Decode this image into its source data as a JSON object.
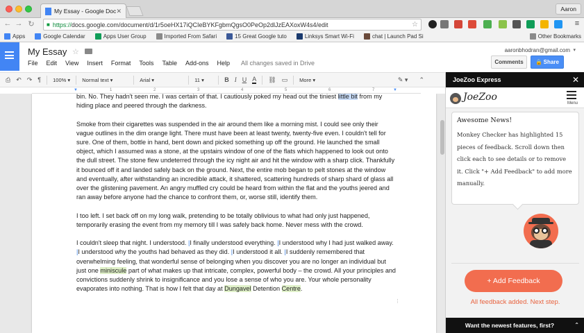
{
  "browser": {
    "tab_title": "My Essay - Google Docs",
    "profile_name": "Aaron",
    "url_scheme": "https://",
    "url_rest": "docs.google.com/document/d/1r5oeHX17iQCIeBYKFgbmQgsO0PeOp2dlJzEAXoxW4s4/edit",
    "bookmarks": [
      {
        "label": "Apps",
        "color": "#4285f4"
      },
      {
        "label": "Google Calendar",
        "color": "#4285f4"
      },
      {
        "label": "Apps User Group",
        "color": "#0f9d58"
      },
      {
        "label": "Imported From Safari",
        "color": "#8a8a8a"
      },
      {
        "label": "15 Great Google tuto",
        "color": "#3b5998"
      },
      {
        "label": "Linksys Smart Wi-Fi",
        "color": "#1a3a6e"
      },
      {
        "label": "chat | Launch Pad Si",
        "color": "#6a4a3a"
      }
    ],
    "other_bookmarks": "Other Bookmarks"
  },
  "docs": {
    "title": "My Essay",
    "menu": [
      "File",
      "Edit",
      "View",
      "Insert",
      "Format",
      "Tools",
      "Table",
      "Add-ons",
      "Help"
    ],
    "save_status": "All changes saved in Drive",
    "account": "aaronbhodran@gmail.com",
    "comments_label": "Comments",
    "share_label": "Share",
    "accent": "#4285f4"
  },
  "toolbar": {
    "zoom": "100%",
    "style": "Normal text",
    "font": "Arial",
    "size": "11",
    "bold": "B",
    "italic": "I",
    "underline": "U",
    "text_color": "A",
    "more": "More"
  },
  "ruler": {
    "marks": [
      "1",
      "2",
      "3",
      "4",
      "5",
      "6",
      "7"
    ]
  },
  "document": {
    "p0_a": "bin.  No.  They hadn't seen me.  I was certain of that.  I cautiously poked my head out the tiniest ",
    "p0_sel": "little bit",
    "p0_b": " from my hiding place and peered through the darkness.",
    "p1": "Smoke from their cigarettes was suspended in the air around them like a morning mist.  I could see only their vague outlines in the dim orange light.  There must have been at least twenty, twenty-five even.  I couldn't tell for sure.  One of them, bottle in hand, bent down and picked something up off the ground.  He launched the small object, which I assumed was a stone, at the upstairs window of one of the flats which happened to look out onto the dull street.  The stone flew undeterred through the icy night air and hit the window with a sharp click.  Thankfully it bounced off it and landed safely back on the ground.  Next, the entire mob began to pelt stones at the window and eventually, after withstanding an incredible attack, it shattered, scattering hundreds of sharp shard of glass all over the glistening pavement.  An angry muffled cry could be heard from within the flat and the youths jeered and ran away before anyone had the chance to confront them, or, worse still, identify them.",
    "p2": "I too left.  I set back off on my long walk, pretending to be totally oblivious to what had only just happened, temporarily erasing the event from my memory till I was safely back home.  Never mess with the crowd.",
    "p3_a": "I couldn't sleep that night.  I understood.  ",
    "p3_b": "I finally understood everything.  ",
    "p3_c": "I understood why I had just walked away.  ",
    "p3_d": "I understood why the youths had behaved as they did.  ",
    "p3_e": "I understood it all.  ",
    "p3_f": "I suddenly remembered that overwhelming feeling, that wonderful sense of belonging when you discover you are no longer an individual but just one ",
    "p3_hl1": "miniscule",
    "p3_g": " part of what makes up that intricate, complex, powerful body – the crowd.  All your principles and convictions suddenly shrink to insignificance and you lose a sense of who you are.  Your whole personality evaporates into nothing.  That is how I felt that day at ",
    "p3_hl2": "Dungavel",
    "p3_h": " Detention ",
    "p3_hl3": "Centre",
    "p3_i": "."
  },
  "joezoo": {
    "header": "JoeZoo Express",
    "close": "✕",
    "logo_text": "JoeZoo",
    "menu_label": "Menu",
    "card_title": "Awesome News!",
    "card_body": "Monkey Checker has highlighted 15 pieces of feedback. Scroll down then click each to see details or to remove it. Click \"+ Add Feedback\" to add more manually.",
    "add_button": "+ Add Feedback",
    "next_step": "All feedback added. Next step.",
    "footer": "Want the newest features, first?",
    "accent": "#f26d4f"
  }
}
